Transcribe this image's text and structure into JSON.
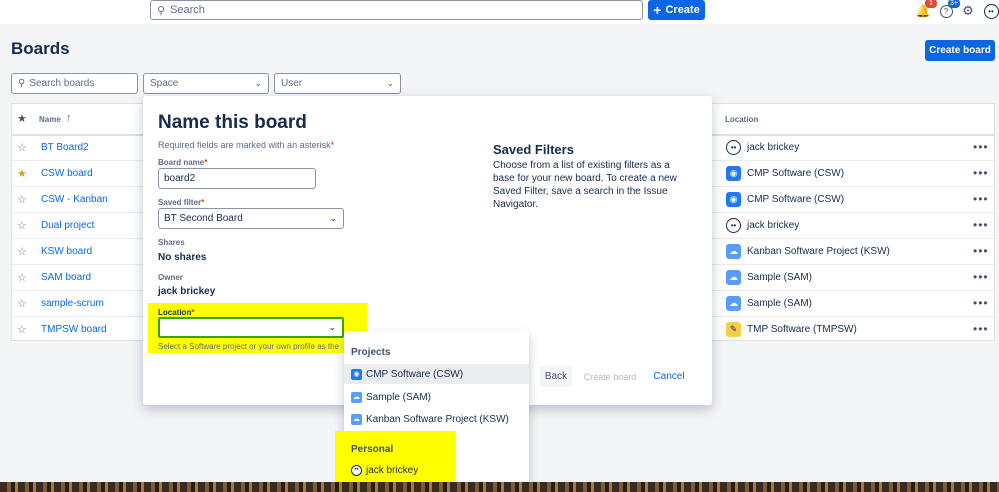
{
  "topbar": {
    "search_placeholder": "Search",
    "create_label": "Create",
    "notifications_count": "1",
    "help_count": "3+"
  },
  "page": {
    "title": "Boards",
    "create_board_label": "Create board"
  },
  "filters": {
    "search_boards_placeholder": "Search boards",
    "space_label": "Space",
    "user_label": "User"
  },
  "table": {
    "col_name": "Name",
    "col_location": "Location",
    "rows": [
      {
        "name": "BT Board2",
        "starred": false,
        "location": "jack brickey",
        "loc_icon": "avatar"
      },
      {
        "name": "CSW board",
        "starred": true,
        "location": "CMP Software (CSW)",
        "loc_icon": "project-csw"
      },
      {
        "name": "CSW - Kanban",
        "starred": false,
        "location": "CMP Software (CSW)",
        "loc_icon": "project-csw"
      },
      {
        "name": "Dual project",
        "starred": false,
        "location": "jack brickey",
        "loc_icon": "avatar"
      },
      {
        "name": "KSW board",
        "starred": false,
        "location": "Kanban Software Project (KSW)",
        "loc_icon": "cloud"
      },
      {
        "name": "SAM board",
        "starred": false,
        "location": "Sample (SAM)",
        "loc_icon": "cloud"
      },
      {
        "name": "sample-scrum",
        "starred": false,
        "location": "Sample (SAM)",
        "loc_icon": "cloud"
      },
      {
        "name": "TMPSW board",
        "starred": false,
        "location": "TMP Software (TMPSW)",
        "loc_icon": "project-tmp"
      }
    ]
  },
  "modal": {
    "title": "Name this board",
    "required_note": "Required fields are marked with an asterisk",
    "board_name_label": "Board name",
    "board_name_value": "board2",
    "saved_filter_label": "Saved filter",
    "saved_filter_value": "BT Second Board",
    "shares_label": "Shares",
    "shares_value": "No shares",
    "owner_label": "Owner",
    "owner_value": "jack brickey",
    "location_label": "Location",
    "location_helper": "Select a Software project or your own profile as the",
    "saved_filters_title": "Saved Filters",
    "saved_filters_desc": "Choose from a list of existing filters as a base for your new board. To create a new Saved Filter, save a search in the Issue Navigator.",
    "back_label": "Back",
    "create_board_label": "Create board",
    "cancel_label": "Cancel"
  },
  "dropdown": {
    "projects_heading": "Projects",
    "projects": [
      {
        "label": "CMP Software (CSW)",
        "active": true
      },
      {
        "label": "Sample (SAM)",
        "active": false
      },
      {
        "label": "Kanban Software Project (KSW)",
        "active": false
      }
    ],
    "personal_heading": "Personal",
    "personal_item": "jack brickey"
  },
  "colors": {
    "brand": "#0c66e4",
    "highlight": "#ffff00",
    "star": "#d9a021",
    "focus": "#36a600"
  }
}
